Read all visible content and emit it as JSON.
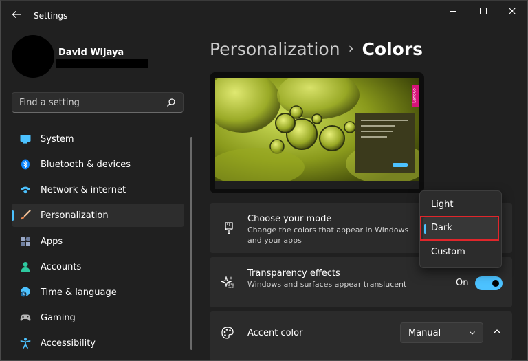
{
  "window": {
    "title": "Settings",
    "minimize": "—",
    "maximize": "☐",
    "close": "✕"
  },
  "user": {
    "name": "David Wijaya"
  },
  "search": {
    "placeholder": "Find a setting"
  },
  "sidebar": {
    "items": [
      {
        "label": "System",
        "icon": "monitor-icon",
        "color": "#4cc2ff"
      },
      {
        "label": "Bluetooth & devices",
        "icon": "bluetooth-icon",
        "color": "#0a84ff"
      },
      {
        "label": "Network & internet",
        "icon": "wifi-icon",
        "color": "#4cc2ff"
      },
      {
        "label": "Personalization",
        "icon": "brush-icon",
        "color": "#f0a36c",
        "active": true
      },
      {
        "label": "Apps",
        "icon": "apps-icon",
        "color": "#9aa9c7"
      },
      {
        "label": "Accounts",
        "icon": "person-icon",
        "color": "#2ec9a0"
      },
      {
        "label": "Time & language",
        "icon": "globe-clock-icon",
        "color": "#4cc2ff"
      },
      {
        "label": "Gaming",
        "icon": "gamepad-icon",
        "color": "#b8b8b8"
      },
      {
        "label": "Accessibility",
        "icon": "accessibility-icon",
        "color": "#4cc2ff"
      }
    ]
  },
  "breadcrumb": {
    "parent": "Personalization",
    "separator": "›",
    "current": "Colors"
  },
  "preview": {
    "brand_tag": "Lenovo"
  },
  "mode_card": {
    "title": "Choose your mode",
    "description": "Change the colors that appear in Windows and your apps"
  },
  "transparency_card": {
    "title": "Transparency effects",
    "description": "Windows and surfaces appear translucent",
    "toggle_label": "On",
    "toggle_on": true
  },
  "accent_card": {
    "title": "Accent color",
    "select_value": "Manual"
  },
  "mode_dropdown": {
    "options": [
      "Light",
      "Dark",
      "Custom"
    ],
    "selected": "Dark"
  },
  "colors": {
    "accent": "#4cc2ff",
    "highlight": "#e0262b",
    "background": "#202020",
    "card": "#2b2b2b"
  }
}
